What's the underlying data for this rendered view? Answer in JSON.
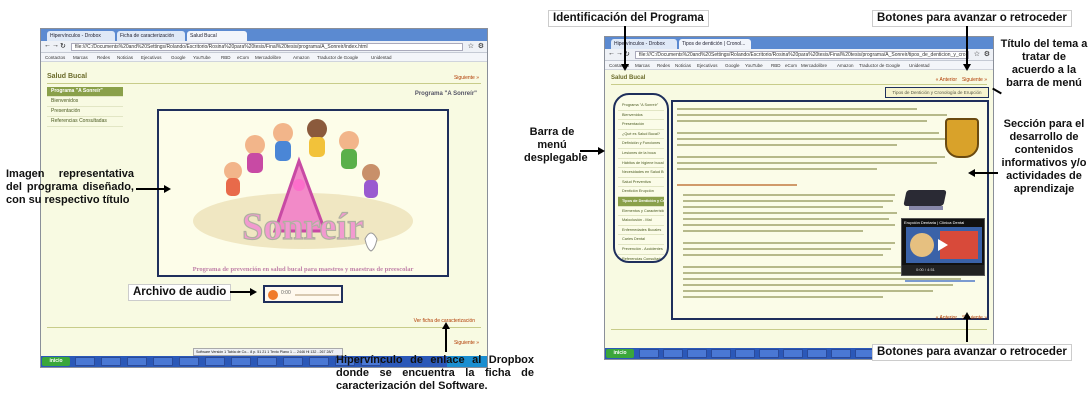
{
  "annotations": {
    "left_image": "Imagen representativa del programa diseñado, con su respectivo título",
    "audio": "Archivo de audio",
    "dropbox": "Hipervínculo de enlace al Dropbox donde se encuentra la ficha de caracterización del Software.",
    "program_id": "Identificación del Programa",
    "nav_top": "Botones para avanzar o retroceder",
    "nav_bottom": "Botones para avanzar o retroceder",
    "topic_title": "Título del tema a tratar de acuerdo a la barra de menú",
    "menu": "Barra de menú desplegable",
    "content": "Sección para el desarrollo de contenidos informativos y/o actividades de aprendizaje"
  },
  "left_browser": {
    "tabs": [
      "Hipervínculos - Drobox",
      "Ficha de caracterización",
      "Salud Bucal"
    ],
    "address": "file:///C:/Documents%20and%20Settings/Rolando/Escritorio/Rosina%20para%20tesis/Final%20tesis/programa/A_Sonreir/index.html",
    "bookmarks": [
      "Contactos",
      "Marcas",
      "Redes",
      "Noticias",
      "Ejecutivos",
      "Google",
      "YouTube",
      "RBD",
      "eCom",
      "Mercadolibre",
      "Amazon",
      "Traductor de Google",
      "Unidentad"
    ],
    "site_title": "Salud Bucal",
    "next_top": "Siguiente »",
    "menu": [
      "Programa \"A Sonreír\"",
      "Bienvenidos",
      "Presentación",
      "Referencias Consultadas"
    ],
    "program_heading": "Programa \"A Sonreír\"",
    "logo_text": "Sonreír",
    "caption": "Programa de prevención en salud bucal para maestros y maestras de preescolar",
    "audio_time": "0:00",
    "dropbox_link": "Ver ficha de caracterización",
    "next_bottom": "Siguiente »",
    "taskbar_start": "inicio",
    "status_text": "Software Versión 1 Tabla de Co... 8 p. 51 21 1 Texto Plano 1 ... 2446 Hi 132 - 267 28/7"
  },
  "right_browser": {
    "tabs": [
      "Hipervínculos - Drobox",
      "Tipos de dentición | Cronol..."
    ],
    "address": "file:///C:/Documents%20and%20Settings/Rolando/Escritorio/Rosina%20para%20tesis/Final%20tesis/programa/A_Sonreir/tipos_de_denticion_y_cro...",
    "bookmarks": [
      "Contactos",
      "Marcas",
      "Redes",
      "Noticias",
      "Ejecutivos",
      "Google",
      "YouTube",
      "RBD",
      "eCom",
      "Mercadolibre",
      "Amazon",
      "Traductor de Google",
      "Unidentad"
    ],
    "site_title": "Salud Bucal",
    "prev_top": "« Anterior",
    "next_top": "Siguiente »",
    "topic_title": "Tipos de Dentición y Cronología de Erupción",
    "menu": [
      "Programa \"A Sonreír\"",
      "Bienvenidos",
      "Presentación",
      "¿Qué es Salud Bucal?",
      "Definición y Funciones",
      "Lesiones de la boca",
      "Hábitos de higiene bucal",
      "Necesidades en Salud Bucal",
      "Salud Preventiva",
      "Dentición Erupción",
      "Tipos de Dentición y Cronología de Erupción",
      "Elementos y Características",
      "Maloclusión - Mal",
      "Enfermedades Bucales",
      "Caries Dental",
      "Prevención - Accidentes",
      "Referencias Consultadas"
    ],
    "active_menu_index": 10,
    "video_title": "Erupción Dentaria | Clínica Dental",
    "video_time": "0:00 / 4:51",
    "prev_bottom": "« Anterior",
    "next_bottom": "Siguiente »",
    "taskbar_start": "inicio"
  },
  "colors": {
    "page_bg": "#f8fae2",
    "content_bg": "#fbfce8",
    "menu_active": "#8aa04a",
    "tab_bar": "#5b8ad1",
    "taskbar": "#2b58b8",
    "link_orange": "#b03a00",
    "annotation_box": "#1f2f5c"
  },
  "icons": [
    "play-icon",
    "close-icon",
    "star-icon",
    "gear-icon",
    "back-arrow-icon",
    "forward-arrow-icon",
    "reload-icon",
    "windows-start-icon",
    "crest-icon",
    "video-play-icon"
  ]
}
